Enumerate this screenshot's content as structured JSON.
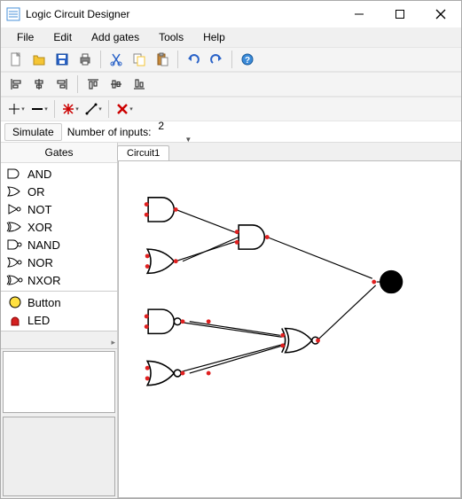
{
  "window": {
    "title": "Logic Circuit Designer"
  },
  "menu": {
    "items": [
      "File",
      "Edit",
      "Add gates",
      "Tools",
      "Help"
    ]
  },
  "toolbar": {
    "buttons": [
      {
        "name": "new-file-icon",
        "tip": "New"
      },
      {
        "name": "open-file-icon",
        "tip": "Open"
      },
      {
        "name": "save-icon",
        "tip": "Save"
      },
      {
        "name": "print-icon",
        "tip": "Print"
      },
      {
        "name": "sep"
      },
      {
        "name": "cut-icon",
        "tip": "Cut"
      },
      {
        "name": "copy-icon",
        "tip": "Copy"
      },
      {
        "name": "paste-icon",
        "tip": "Paste"
      },
      {
        "name": "sep"
      },
      {
        "name": "undo-icon",
        "tip": "Undo"
      },
      {
        "name": "redo-icon",
        "tip": "Redo"
      },
      {
        "name": "sep"
      },
      {
        "name": "help-icon",
        "tip": "Help"
      }
    ]
  },
  "aligntoolbar": {
    "buttons": [
      {
        "name": "align-left-icon"
      },
      {
        "name": "align-center-icon"
      },
      {
        "name": "align-right-icon"
      },
      {
        "name": "sep"
      },
      {
        "name": "align-top-icon"
      },
      {
        "name": "align-middle-icon"
      },
      {
        "name": "align-bottom-icon"
      }
    ]
  },
  "wiretoolbar": {
    "buttons": [
      {
        "name": "wire-cross-icon"
      },
      {
        "name": "wire-line-icon"
      },
      {
        "name": "sep"
      },
      {
        "name": "node-star-icon"
      },
      {
        "name": "wire-diag-icon"
      },
      {
        "name": "sep"
      },
      {
        "name": "delete-x-icon"
      }
    ]
  },
  "simulate": {
    "button_label": "Simulate",
    "ninputs_label": "Number of inputs:",
    "ninputs_value": "2"
  },
  "sidebar": {
    "header": "Gates",
    "gates": [
      "AND",
      "OR",
      "NOT",
      "XOR",
      "NAND",
      "NOR",
      "NXOR"
    ],
    "io": [
      "Button",
      "LED"
    ]
  },
  "tabs": {
    "active": "Circuit1"
  },
  "colors": {
    "node": "#e02020",
    "gate_stroke": "#000000",
    "icon_blue": "#2a63c8",
    "icon_yellow": "#f5c534",
    "led_red": "#d42020"
  }
}
